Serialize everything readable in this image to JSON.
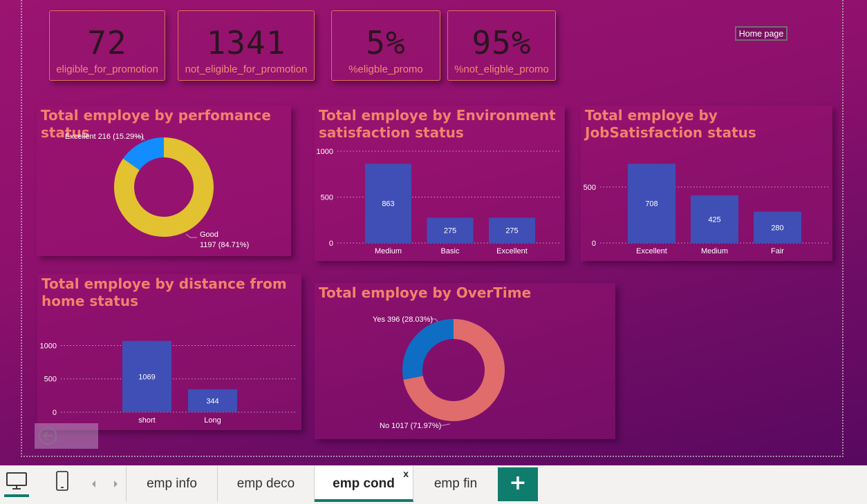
{
  "kpis": [
    {
      "value": "72",
      "label": "eligible_for_promotion"
    },
    {
      "value": "1341",
      "label": "not_eligible_for_promotion"
    },
    {
      "value": "5%",
      "label": "%eligble_promo"
    },
    {
      "value": "95%",
      "label": "%not_eligble_promo"
    }
  ],
  "home_button": "Home page",
  "panels": {
    "performance": {
      "title": "Total employe by perfomance status"
    },
    "environment": {
      "title": "Total employe by Environment satisfaction status"
    },
    "job": {
      "title": "Total employe by JobSatisfaction status"
    },
    "distance": {
      "title": "Total employe by distance from home status"
    },
    "overtime": {
      "title": "Total employe by OverTime"
    }
  },
  "chart_data": [
    {
      "type": "pie",
      "title": "Total employe by perfomance status",
      "donut": true,
      "slices": [
        {
          "label": "Excellent",
          "value": 216,
          "pct": "15.29%",
          "color": "#118dff"
        },
        {
          "label": "Good",
          "value": 1197,
          "pct": "84.71%",
          "color": "#e2c231"
        }
      ]
    },
    {
      "type": "bar",
      "title": "Total employe by Environment satisfaction status",
      "categories": [
        "Medium",
        "Basic",
        "Excellent"
      ],
      "values": [
        863,
        275,
        275
      ],
      "yticks": [
        "0",
        "500",
        "1000"
      ],
      "ylim": [
        0,
        1000
      ],
      "color": "#3f4fb5"
    },
    {
      "type": "bar",
      "title": "Total employe by JobSatisfaction status",
      "categories": [
        "Excellent",
        "Medium",
        "Fair"
      ],
      "values": [
        708,
        425,
        280
      ],
      "yticks": [
        "0",
        "500"
      ],
      "ylim": [
        0,
        820
      ],
      "color": "#3f4fb5"
    },
    {
      "type": "bar",
      "title": "Total employe by distance from home status",
      "categories": [
        "short",
        "Long"
      ],
      "values": [
        1069,
        344
      ],
      "yticks": [
        "0",
        "500",
        "1000"
      ],
      "ylim": [
        0,
        1160
      ],
      "color": "#3f4fb5"
    },
    {
      "type": "pie",
      "title": "Total employe by OverTime",
      "donut": true,
      "slices": [
        {
          "label": "Yes",
          "value": 396,
          "pct": "28.03%",
          "color": "#0f6dc4"
        },
        {
          "label": "No",
          "value": 1017,
          "pct": "71.97%",
          "color": "#e06c6c"
        }
      ]
    }
  ],
  "tabs": [
    {
      "label": "emp info",
      "active": false
    },
    {
      "label": "emp deco",
      "active": false
    },
    {
      "label": "emp cond",
      "active": true
    },
    {
      "label": "emp fin",
      "active": false
    }
  ],
  "tab_close": "x",
  "add_tab": "+",
  "icons": {
    "desktop": "desktop-view-icon",
    "mobile": "mobile-view-icon",
    "prev": "chevron-left-icon",
    "next": "chevron-right-icon",
    "back": "back-arrow-icon"
  }
}
